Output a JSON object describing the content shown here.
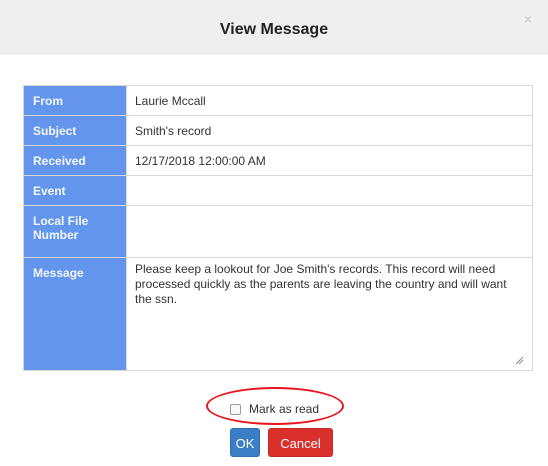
{
  "dialog": {
    "title": "View Message",
    "close_symbol": "×"
  },
  "fields": [
    {
      "label": "From",
      "value": "Laurie Mccall"
    },
    {
      "label": "Subject",
      "value": "Smith's record"
    },
    {
      "label": "Received",
      "value": "12/17/2018 12:00:00 AM"
    },
    {
      "label": "Event",
      "value": ""
    },
    {
      "label": "Local File Number",
      "value": ""
    },
    {
      "label": "Message",
      "value": "Please keep a lookout for Joe Smith's records.  This record will need processed quickly as the parents are leaving the country and will want the ssn."
    }
  ],
  "mark_as_read": {
    "label": "Mark as read",
    "checked": false
  },
  "buttons": {
    "ok": "OK",
    "cancel": "Cancel"
  },
  "colors": {
    "label_bg": "#6495ed",
    "ok_bg": "#3b7ec6",
    "cancel_bg": "#d9302b",
    "highlight": "#e8141b"
  }
}
